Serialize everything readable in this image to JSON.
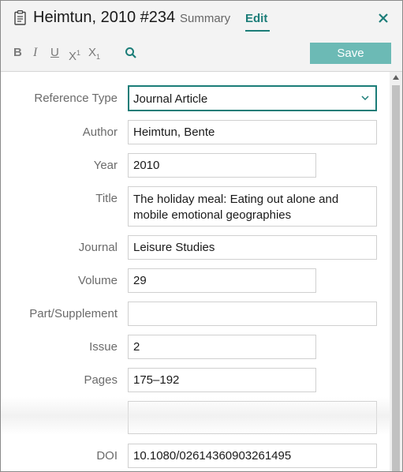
{
  "header": {
    "title": "Heimtun, 2010 #234",
    "tabs": [
      {
        "label": "Summary",
        "active": false
      },
      {
        "label": "Edit",
        "active": true
      }
    ],
    "close_icon": "close-icon",
    "accent_color": "#1b7d78"
  },
  "toolbar": {
    "bold": "B",
    "italic": "I",
    "underline": "U",
    "superscript": "X",
    "superscript_mark": "1",
    "subscript": "X",
    "subscript_mark": "1",
    "search_icon": "search-icon",
    "save_label": "Save"
  },
  "form": {
    "reference_type": {
      "label": "Reference Type",
      "value": "Journal Article"
    },
    "author": {
      "label": "Author",
      "value": "Heimtun, Bente"
    },
    "year": {
      "label": "Year",
      "value": "2010"
    },
    "title": {
      "label": "Title",
      "value": "The holiday meal: Eating out alone and mobile emotional geographies"
    },
    "journal": {
      "label": "Journal",
      "value": "Leisure Studies"
    },
    "volume": {
      "label": "Volume",
      "value": "29"
    },
    "part_supplement": {
      "label": "Part/Supplement",
      "value": ""
    },
    "issue": {
      "label": "Issue",
      "value": "2"
    },
    "pages": {
      "label": "Pages",
      "value": "175–192"
    },
    "unlabeled": {
      "value": ""
    },
    "doi": {
      "label": "DOI",
      "value": "10.1080/02614360903261495"
    }
  }
}
